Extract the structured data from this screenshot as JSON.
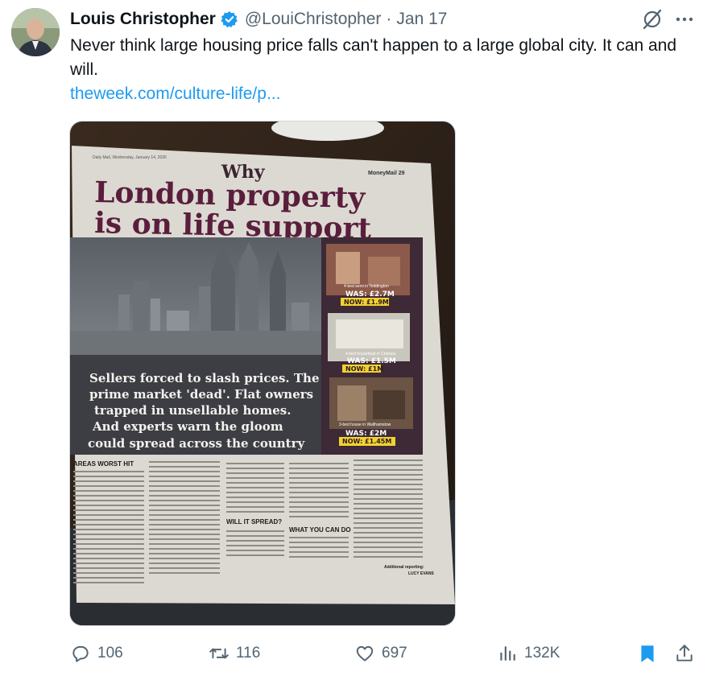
{
  "tweet": {
    "author_name": "Louis Christopher",
    "handle": "@LouiChristopher",
    "separator": "·",
    "date": "Jan 17",
    "text": "Never think large housing price falls can't happen to a large global city. It can and will.",
    "link": "theweek.com/culture-life/p..."
  },
  "newspaper": {
    "masthead": "Daily Mail, Wednesday, January 14, 2026",
    "section": "MoneyMail 29",
    "kicker": "Why",
    "headline_1": "London property",
    "headline_2": "is on life support",
    "standfirst": [
      "Sellers forced to slash prices. The",
      "prime market 'dead'. Flat owners",
      "trapped in unsellable homes.",
      "And experts warn the gloom",
      "could spread across the country"
    ],
    "listings": [
      {
        "caption": "4-bed semi in Teddington",
        "was": "WAS: £2.7M",
        "now": "NOW: £1.9M"
      },
      {
        "caption": "4-bed houseboat in Chelsea",
        "was": "WAS: £1.5M",
        "now": "NOW: £1M"
      },
      {
        "caption": "3-bed house in Walthamstow",
        "was": "WAS: £2M",
        "now": "NOW: £1.45M"
      }
    ],
    "subheads": [
      "AREAS WORST HIT",
      "WILL IT SPREAD?",
      "WHAT YOU CAN DO"
    ],
    "byline_1": "Additional reporting:",
    "byline_2": "LUCY EVANS"
  },
  "actions": {
    "reply_count": "106",
    "retweet_count": "116",
    "like_count": "697",
    "views_count": "132K"
  },
  "colors": {
    "link": "#1d9bf0",
    "verified": "#1d9bf0",
    "bookmark": "#1d9bf0",
    "headline": "#5a1e3c"
  }
}
